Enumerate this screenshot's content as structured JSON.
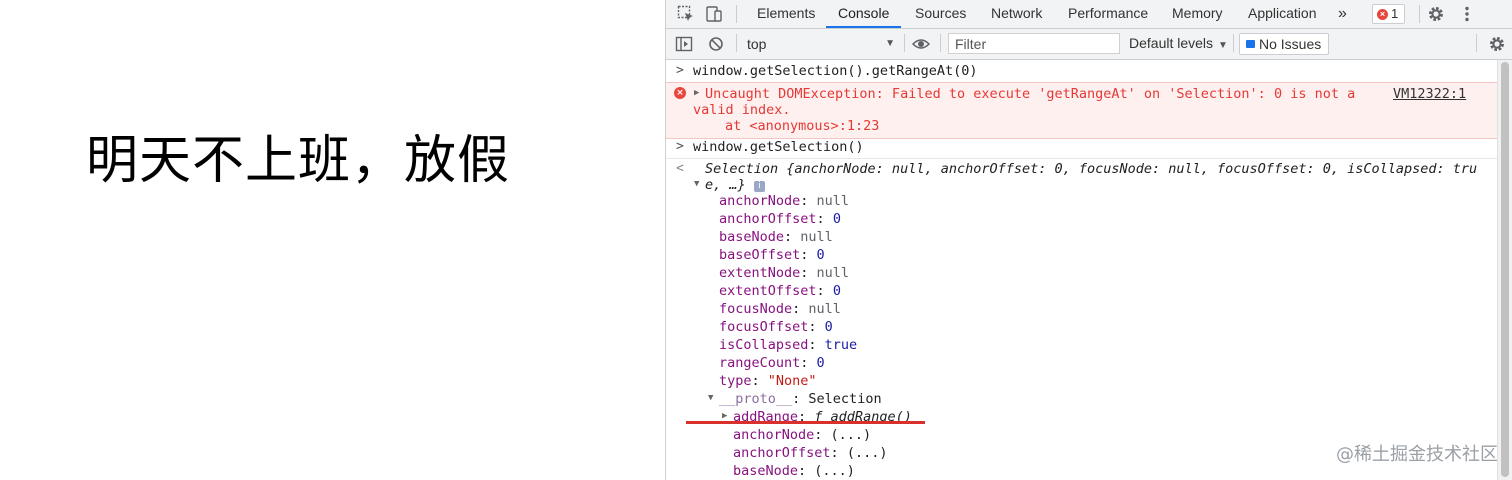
{
  "page": {
    "text": "明天不上班，放假"
  },
  "devtools": {
    "tabs": [
      "Elements",
      "Console",
      "Sources",
      "Network",
      "Performance",
      "Memory",
      "Application"
    ],
    "more_tabs": "»",
    "error_count": "1",
    "toolbar": {
      "context": "top",
      "filter_placeholder": "Filter",
      "levels": "Default levels",
      "issues": "No Issues"
    }
  },
  "console": {
    "cmd1": "window.getSelection().getRangeAt(0)",
    "error": {
      "line1": "Uncaught DOMException: Failed to execute 'getRangeAt' on 'Selection': 0 is not a",
      "line2": "valid index.",
      "line3": "at <anonymous>:1:23",
      "source": "VM12322:1"
    },
    "cmd2": "window.getSelection()",
    "result_line1": "Selection {anchorNode: null, anchorOffset: 0, focusNode: null, focusOffset: 0, isCollapsed: tru",
    "result_line2": "e, …}",
    "props": [
      {
        "key": "anchorNode",
        "value": "null",
        "type": "null"
      },
      {
        "key": "anchorOffset",
        "value": "0",
        "type": "num"
      },
      {
        "key": "baseNode",
        "value": "null",
        "type": "null"
      },
      {
        "key": "baseOffset",
        "value": "0",
        "type": "num"
      },
      {
        "key": "extentNode",
        "value": "null",
        "type": "null"
      },
      {
        "key": "extentOffset",
        "value": "0",
        "type": "num"
      },
      {
        "key": "focusNode",
        "value": "null",
        "type": "null"
      },
      {
        "key": "focusOffset",
        "value": "0",
        "type": "num"
      },
      {
        "key": "isCollapsed",
        "value": "true",
        "type": "bool"
      },
      {
        "key": "rangeCount",
        "value": "0",
        "type": "num"
      },
      {
        "key": "type",
        "value": "\"None\"",
        "type": "str"
      }
    ],
    "proto_key": "__proto__",
    "proto_value": "Selection",
    "proto_items": [
      {
        "key": "addRange",
        "value": "ƒ addRange()"
      },
      {
        "key": "anchorNode",
        "value": "(...)"
      },
      {
        "key": "anchorOffset",
        "value": "(...)"
      },
      {
        "key": "baseNode",
        "value": "(...)"
      }
    ]
  },
  "watermark": "@稀土掘金技术社区",
  "colors": {
    "error_red": "#e53935",
    "active_tab": "#1a73e8",
    "annotation_red": "#d9302b"
  }
}
